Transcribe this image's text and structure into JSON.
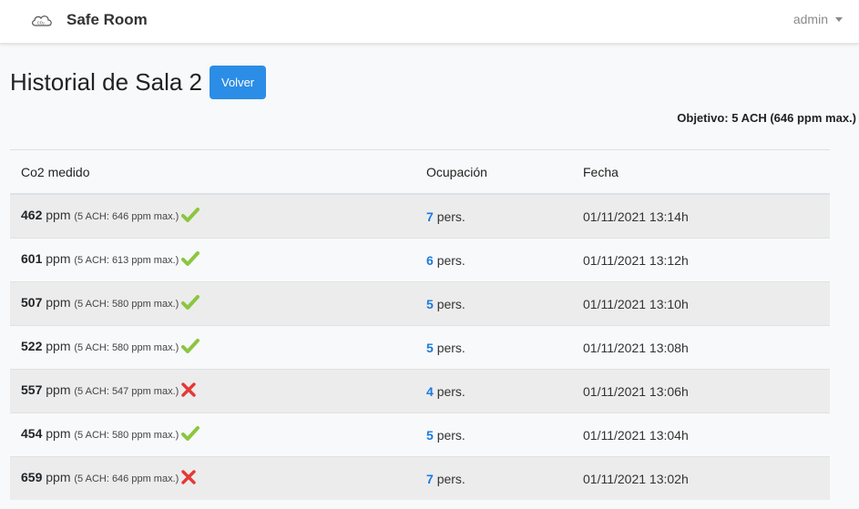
{
  "app": {
    "title": "Safe Room",
    "user": "admin"
  },
  "page": {
    "title": "Historial de Sala 2",
    "back_label": "Volver",
    "objective": "Objetivo: 5 ACH (646 ppm max.)"
  },
  "table": {
    "headers": [
      "Co2 medido",
      "Ocupación",
      "Fecha"
    ],
    "rows": [
      {
        "co2": "462",
        "unit": "ppm",
        "limit": "(5 ACH: 646 ppm max.)",
        "status": "ok",
        "occupancy": "7",
        "occ_unit": "pers.",
        "date": "01/11/2021 13:14h"
      },
      {
        "co2": "601",
        "unit": "ppm",
        "limit": "(5 ACH: 613 ppm max.)",
        "status": "ok",
        "occupancy": "6",
        "occ_unit": "pers.",
        "date": "01/11/2021 13:12h"
      },
      {
        "co2": "507",
        "unit": "ppm",
        "limit": "(5 ACH: 580 ppm max.)",
        "status": "ok",
        "occupancy": "5",
        "occ_unit": "pers.",
        "date": "01/11/2021 13:10h"
      },
      {
        "co2": "522",
        "unit": "ppm",
        "limit": "(5 ACH: 580 ppm max.)",
        "status": "ok",
        "occupancy": "5",
        "occ_unit": "pers.",
        "date": "01/11/2021 13:08h"
      },
      {
        "co2": "557",
        "unit": "ppm",
        "limit": "(5 ACH: 547 ppm max.)",
        "status": "fail",
        "occupancy": "4",
        "occ_unit": "pers.",
        "date": "01/11/2021 13:06h"
      },
      {
        "co2": "454",
        "unit": "ppm",
        "limit": "(5 ACH: 580 ppm max.)",
        "status": "ok",
        "occupancy": "5",
        "occ_unit": "pers.",
        "date": "01/11/2021 13:04h"
      },
      {
        "co2": "659",
        "unit": "ppm",
        "limit": "(5 ACH: 646 ppm max.)",
        "status": "fail",
        "occupancy": "7",
        "occ_unit": "pers.",
        "date": "01/11/2021 13:02h"
      }
    ]
  },
  "icons": {
    "brand": "cloud-co2-icon",
    "ok": "check-icon",
    "fail": "cross-icon"
  },
  "colors": {
    "accent": "#2c8de6",
    "link": "#1a7ae0",
    "ok": "#8cc63f",
    "fail": "#e53935"
  }
}
